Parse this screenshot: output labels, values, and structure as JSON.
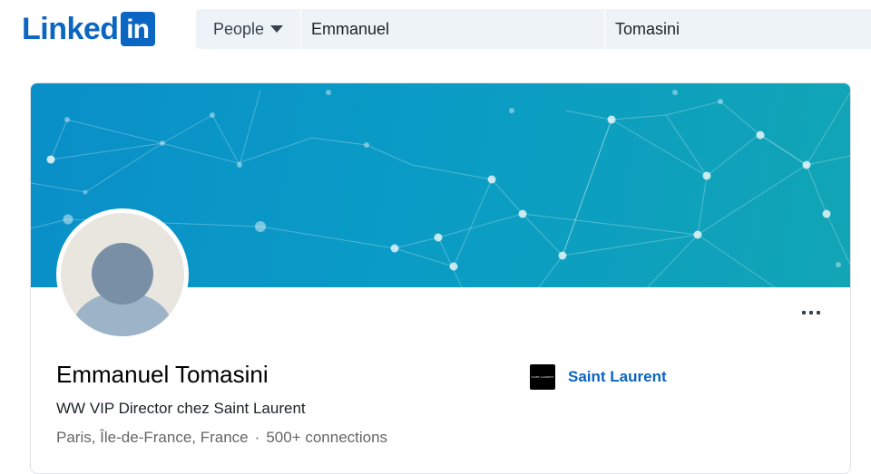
{
  "brand": {
    "logo_word": "Linked",
    "logo_box": "in",
    "color": "#0a66c2"
  },
  "search": {
    "type_label": "People",
    "first_name_value": "Emmanuel",
    "last_name_value": "Tomasini"
  },
  "profile": {
    "name": "Emmanuel Tomasini",
    "headline": "WW VIP Director chez Saint Laurent",
    "location": "Paris, Île-de-France, France",
    "separator": "·",
    "connections": "500+ connections",
    "company": {
      "name": "Saint Laurent",
      "logo_text": "SAINT LAURENT"
    }
  },
  "colors": {
    "cover_start": "#0a8fc8",
    "cover_end": "#11a5b5",
    "link": "#0a66c2"
  },
  "icons": {
    "more": "more-horizontal-icon",
    "caret": "caret-down-icon",
    "avatar": "default-avatar-icon"
  }
}
